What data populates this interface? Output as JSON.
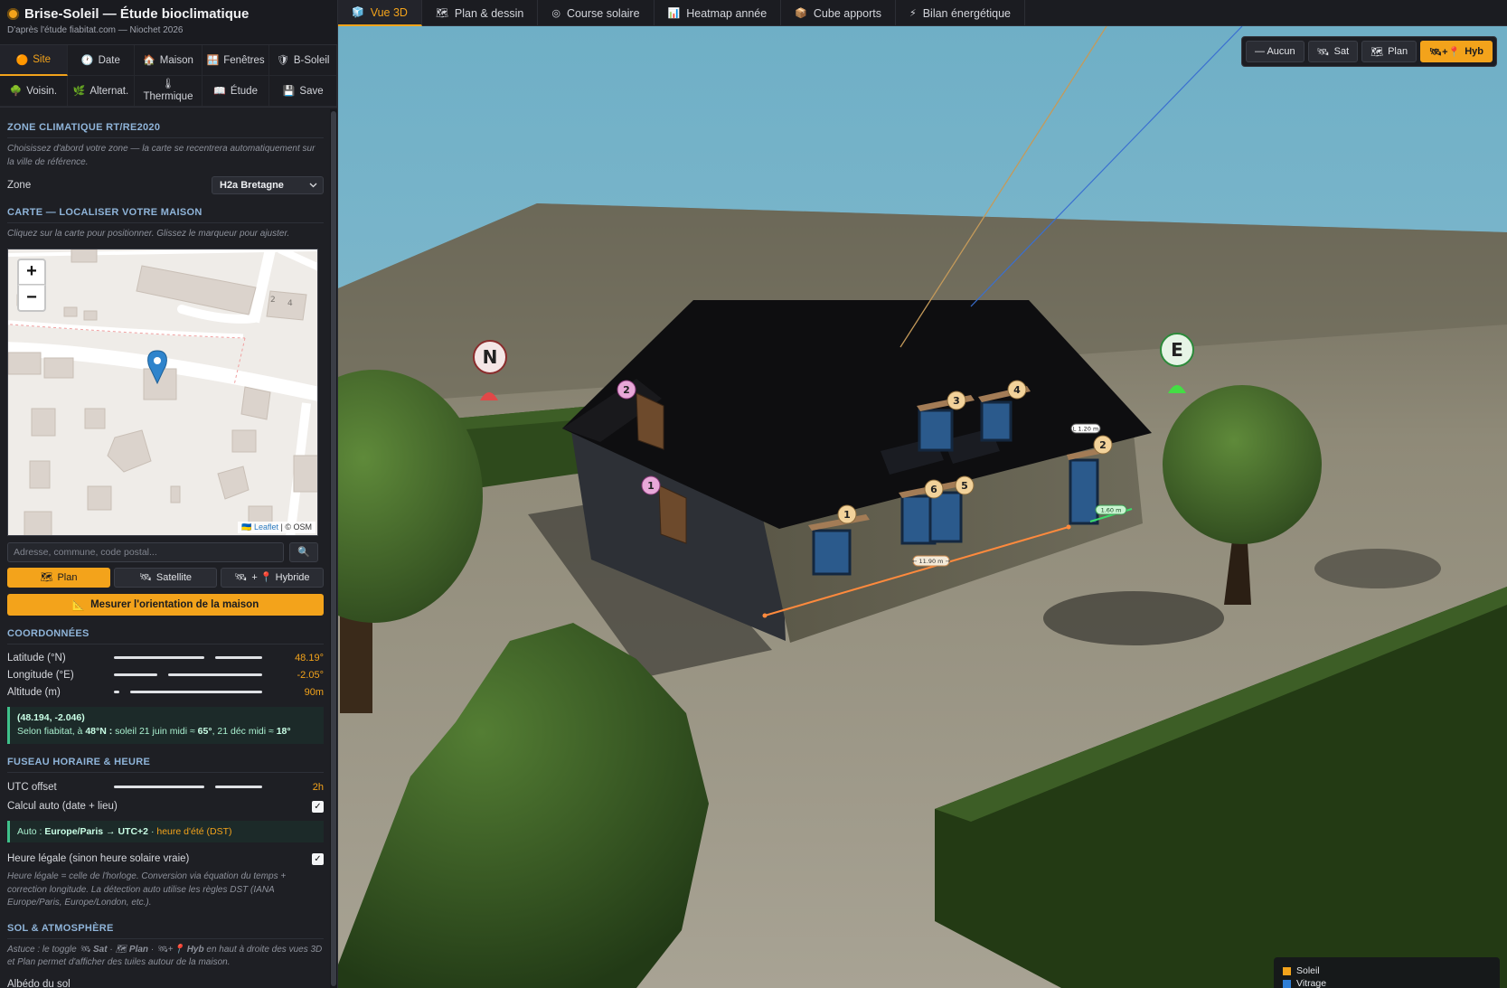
{
  "app": {
    "title": "Brise-Soleil — Étude bioclimatique",
    "subtitle": "D'après l'étude fiabitat.com — Niochet 2026"
  },
  "sidebar_tabs": [
    {
      "icon": "sun-icon",
      "label": "Site",
      "active": true
    },
    {
      "icon": "clock-icon",
      "label": "Date"
    },
    {
      "icon": "house-icon",
      "label": "Maison"
    },
    {
      "icon": "window-icon",
      "label": "Fenêtres"
    },
    {
      "icon": "shield-icon",
      "label": "B-Soleil"
    },
    {
      "icon": "tree-icon",
      "label": "Voisin."
    },
    {
      "icon": "leaf-icon",
      "label": "Alternat."
    },
    {
      "icon": "thermometer-icon",
      "label": "Thermique"
    },
    {
      "icon": "book-icon",
      "label": "Étude"
    },
    {
      "icon": "save-icon",
      "label": "Save"
    }
  ],
  "climate": {
    "title": "ZONE CLIMATIQUE RT/RE2020",
    "desc": "Choisissez d'abord votre zone — la carte se recentrera automatiquement sur la ville de référence.",
    "zone_label": "Zone",
    "zone_value": "H2a Bretagne"
  },
  "map": {
    "title": "CARTE — LOCALISER VOTRE MAISON",
    "desc": "Cliquez sur la carte pour positionner. Glissez le marqueur pour ajuster.",
    "zoom_in": "+",
    "zoom_out": "−",
    "attrib_leaflet": "Leaflet",
    "attrib_osm": "| © OSM",
    "house_number_1": "2",
    "house_number_2": "4",
    "search_placeholder": "Adresse, commune, code postal...",
    "mode_plan": "Plan",
    "mode_satellite": "Satellite",
    "mode_hybrid": "+ 📍 Hybride",
    "measure_button": "Mesurer l'orientation de la maison"
  },
  "coords": {
    "title": "COORDONNÉES",
    "lat_label": "Latitude (°N)",
    "lat_value": "48.19°",
    "lon_label": "Longitude (°E)",
    "lon_value": "-2.05°",
    "alt_label": "Altitude (m)",
    "alt_value": "90m",
    "info_coords": "(48.194, -2.046)",
    "info_text_a": "Selon fiabitat, à ",
    "info_lat": "48°N :",
    "info_text_b": " soleil 21 juin midi ≈ ",
    "info_june": "65°",
    "info_text_c": ", 21 déc midi ≈ ",
    "info_dec": "18°"
  },
  "timezone": {
    "title": "FUSEAU HORAIRE & HEURE",
    "utc_label": "UTC offset",
    "utc_value": "2h",
    "auto_label": "Calcul auto (date + lieu)",
    "auto_text_a": "Auto : ",
    "auto_zone": "Europe/Paris → UTC+2",
    "auto_text_b": " · ",
    "auto_dst": "heure d'été (DST)",
    "legal_label": "Heure légale (sinon heure solaire vraie)",
    "legal_desc": "Heure légale = celle de l'horloge. Conversion via équation du temps + correction longitude. La détection auto utilise les règles DST (IANA Europe/Paris, Europe/London, etc.)."
  },
  "soil": {
    "title": "SOL & ATMOSPHÈRE",
    "tip_a": "Astuce : le toggle ",
    "tip_sat": "Sat",
    "tip_plan": "Plan",
    "tip_hyb": "Hyb",
    "tip_b": " en haut à droite des vues 3D et Plan permet d'afficher des tuiles autour de la maison.",
    "albedo_label": "Albédo du sol"
  },
  "top_tabs": [
    {
      "icon": "cube-icon",
      "label": "Vue 3D",
      "active": true
    },
    {
      "icon": "map-icon",
      "label": "Plan & dessin"
    },
    {
      "icon": "circle-icon",
      "label": "Course solaire"
    },
    {
      "icon": "chart-icon",
      "label": "Heatmap année"
    },
    {
      "icon": "box-icon",
      "label": "Cube apports"
    },
    {
      "icon": "bolt-icon",
      "label": "Bilan énergétique"
    }
  ],
  "basemap": {
    "none": "— Aucun",
    "sat": "Sat",
    "plan": "Plan",
    "hyb": "Hyb",
    "selected": "Hyb"
  },
  "scene": {
    "compass_n": "N",
    "compass_e": "E",
    "win_labels": [
      "1",
      "2",
      "3",
      "4",
      "5",
      "6",
      "1",
      "2"
    ],
    "dim_length": "← 11.90 m →",
    "dim_depth": "1.60 m",
    "dim_height": "L 1.20 m"
  },
  "legend": {
    "items": [
      {
        "label": "Soleil",
        "color": "#f3a31b"
      },
      {
        "label": "Vitrage",
        "color": "#2f7fd6"
      }
    ]
  },
  "colors": {
    "accent": "#f3a31b",
    "sky": "#74b1c8",
    "info_green": "#3fc08a"
  }
}
